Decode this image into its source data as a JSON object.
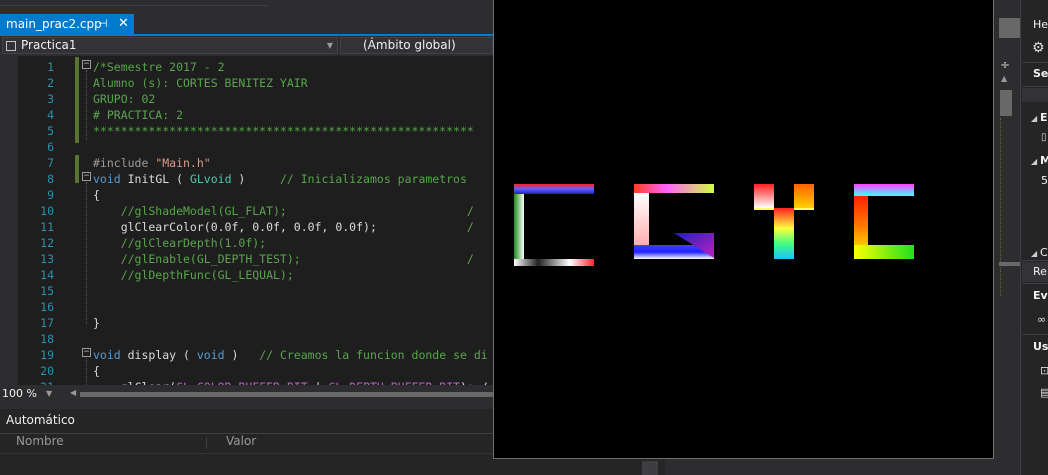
{
  "editor_tab": {
    "filename": "main_prac2.cpp",
    "pin_icon": "pin-icon",
    "close_icon": "close-icon"
  },
  "navigation": {
    "project": "Practica1",
    "scope": "(Ámbito global)"
  },
  "code_lines": [
    {
      "n": "1",
      "segments": [
        {
          "t": "/*Semestre 2017 - 2",
          "c": "cm"
        }
      ]
    },
    {
      "n": "2",
      "segments": [
        {
          "t": "Alumno (s): CORTES BENITEZ YAIR",
          "c": "cm"
        }
      ]
    },
    {
      "n": "3",
      "segments": [
        {
          "t": "GRUPO: 02",
          "c": "cm"
        }
      ]
    },
    {
      "n": "4",
      "segments": [
        {
          "t": "# PRACTICA: 2",
          "c": "cm"
        }
      ]
    },
    {
      "n": "5",
      "segments": [
        {
          "t": "*******************************************************",
          "c": "cm"
        }
      ]
    },
    {
      "n": "6",
      "segments": []
    },
    {
      "n": "7",
      "segments": [
        {
          "t": "#include ",
          "c": "pp"
        },
        {
          "t": "\"Main.h\"",
          "c": "str"
        }
      ]
    },
    {
      "n": "8",
      "segments": [
        {
          "t": "void",
          "c": "kw"
        },
        {
          "t": " InitGL ( ",
          "c": ""
        },
        {
          "t": "GLvoid",
          "c": "typ"
        },
        {
          "t": " )     ",
          "c": ""
        },
        {
          "t": "// Inicializamos parametros",
          "c": "cm"
        }
      ]
    },
    {
      "n": "9",
      "segments": [
        {
          "t": "{",
          "c": ""
        }
      ]
    },
    {
      "n": "10",
      "segments": [
        {
          "t": "    //glShadeModel(GL_FLAT);                          /",
          "c": "cm"
        }
      ]
    },
    {
      "n": "11",
      "segments": [
        {
          "t": "    glClearColor(0.0f, 0.0f, 0.0f, 0.0f);             ",
          "c": ""
        },
        {
          "t": "/",
          "c": "cm"
        }
      ]
    },
    {
      "n": "12",
      "segments": [
        {
          "t": "    //glClearDepth(1.0f);",
          "c": "cm"
        }
      ]
    },
    {
      "n": "13",
      "segments": [
        {
          "t": "    //glEnable(GL_DEPTH_TEST);                        /",
          "c": "cm"
        }
      ]
    },
    {
      "n": "14",
      "segments": [
        {
          "t": "    //glDepthFunc(GL_LEQUAL);",
          "c": "cm"
        }
      ]
    },
    {
      "n": "15",
      "segments": []
    },
    {
      "n": "16",
      "segments": []
    },
    {
      "n": "17",
      "segments": [
        {
          "t": "}",
          "c": ""
        }
      ]
    },
    {
      "n": "18",
      "segments": []
    },
    {
      "n": "19",
      "segments": [
        {
          "t": "void",
          "c": "kw"
        },
        {
          "t": " display ( ",
          "c": ""
        },
        {
          "t": "void",
          "c": "kw"
        },
        {
          "t": " )   ",
          "c": ""
        },
        {
          "t": "// Creamos la funcion donde se di",
          "c": "cm"
        }
      ]
    },
    {
      "n": "20",
      "segments": [
        {
          "t": "{",
          "c": ""
        }
      ]
    },
    {
      "n": "21",
      "segments": [
        {
          "t": "    glClear(",
          "c": ""
        },
        {
          "t": "GL_COLOR_BUFFER_BIT",
          "c": "mac"
        },
        {
          "t": " | ",
          "c": ""
        },
        {
          "t": "GL_DEPTH_BUFFER_BIT",
          "c": "mac"
        },
        {
          "t": "); /",
          "c": ""
        }
      ]
    }
  ],
  "zoom": "100 %",
  "autos_panel": {
    "title": "Automático",
    "columns": [
      "Nombre",
      "Valor"
    ]
  },
  "right_panel": {
    "items": [
      "Her",
      "Se",
      "E",
      "M",
      "5",
      "C",
      "Re",
      "Eve",
      "Us"
    ],
    "icons": [
      "gear-icon",
      "link-icon",
      "clipboard-icon",
      "stack-icon"
    ]
  },
  "gl_letters": [
    "C",
    "G",
    "Y",
    "C"
  ],
  "colors": {
    "accent": "#007acc",
    "editor_bg": "#1e1e1e",
    "line_number": "#2b91af",
    "comment": "#57a64a",
    "keyword": "#569cd6",
    "string": "#d69d85",
    "macro": "#bd63c5",
    "type": "#4ec9b0"
  }
}
